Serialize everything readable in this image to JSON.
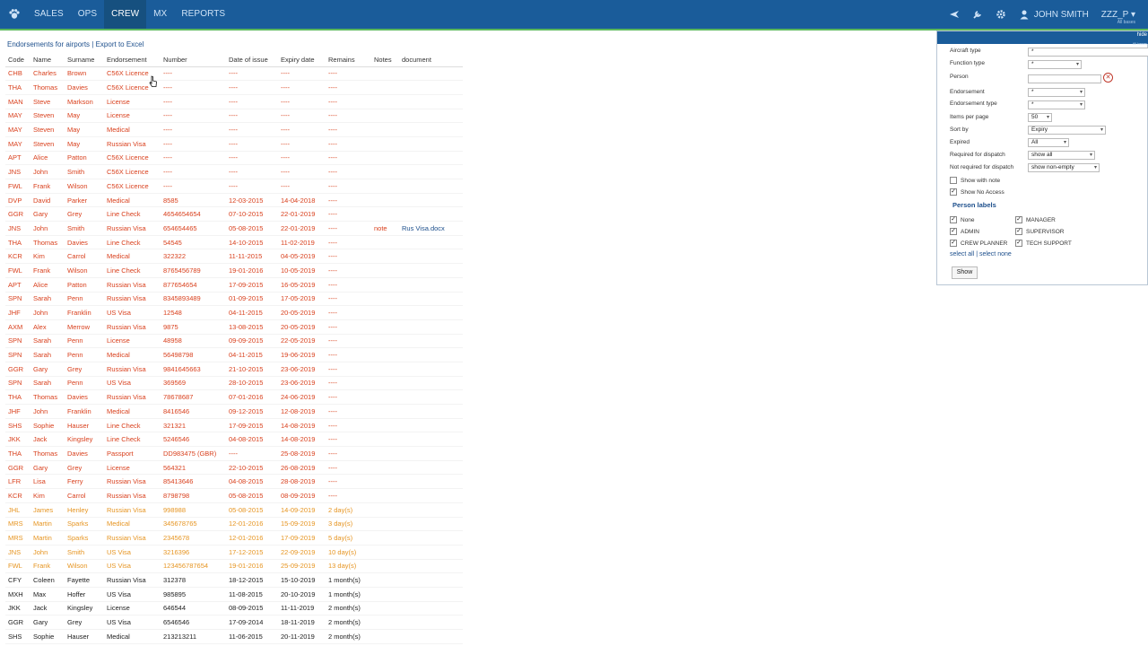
{
  "nav": {
    "items": [
      {
        "label": "SALES",
        "active": false
      },
      {
        "label": "OPS",
        "active": false
      },
      {
        "label": "CREW",
        "active": true
      },
      {
        "label": "MX",
        "active": false
      },
      {
        "label": "REPORTS",
        "active": false
      }
    ],
    "user_name": "JOHN SMITH",
    "workspace": "ZZZ_P",
    "workspace_sub": "All bases"
  },
  "breadcrumb": {
    "title": "Endorsements for airports",
    "separator": "|",
    "export_link": "Export to Excel"
  },
  "table": {
    "headers": [
      "Code",
      "Name",
      "Surname",
      "Endorsement",
      "Number",
      "Date of issue",
      "Expiry date",
      "Remains",
      "Notes",
      "document"
    ],
    "rows": [
      {
        "code": "CHB",
        "name": "Charles",
        "surname": "Brown",
        "endorsement": "C56X Licence",
        "number": "----",
        "issue": "----",
        "expiry": "----",
        "remains": "----",
        "notes": "",
        "document": "",
        "status": "expired"
      },
      {
        "code": "THA",
        "name": "Thomas",
        "surname": "Davies",
        "endorsement": "C56X Licence",
        "number": "----",
        "issue": "----",
        "expiry": "----",
        "remains": "----",
        "notes": "",
        "document": "",
        "status": "expired"
      },
      {
        "code": "MAN",
        "name": "Steve",
        "surname": "Markson",
        "endorsement": "License",
        "number": "----",
        "issue": "----",
        "expiry": "----",
        "remains": "----",
        "notes": "",
        "document": "",
        "status": "expired"
      },
      {
        "code": "MAY",
        "name": "Steven",
        "surname": "May",
        "endorsement": "License",
        "number": "----",
        "issue": "----",
        "expiry": "----",
        "remains": "----",
        "notes": "",
        "document": "",
        "status": "expired"
      },
      {
        "code": "MAY",
        "name": "Steven",
        "surname": "May",
        "endorsement": "Medical",
        "number": "----",
        "issue": "----",
        "expiry": "----",
        "remains": "----",
        "notes": "",
        "document": "",
        "status": "expired"
      },
      {
        "code": "MAY",
        "name": "Steven",
        "surname": "May",
        "endorsement": "Russian Visa",
        "number": "----",
        "issue": "----",
        "expiry": "----",
        "remains": "----",
        "notes": "",
        "document": "",
        "status": "expired"
      },
      {
        "code": "APT",
        "name": "Alice",
        "surname": "Patton",
        "endorsement": "C56X Licence",
        "number": "----",
        "issue": "----",
        "expiry": "----",
        "remains": "----",
        "notes": "",
        "document": "",
        "status": "expired"
      },
      {
        "code": "JNS",
        "name": "John",
        "surname": "Smith",
        "endorsement": "C56X Licence",
        "number": "----",
        "issue": "----",
        "expiry": "----",
        "remains": "----",
        "notes": "",
        "document": "",
        "status": "expired"
      },
      {
        "code": "FWL",
        "name": "Frank",
        "surname": "Wilson",
        "endorsement": "C56X Licence",
        "number": "----",
        "issue": "----",
        "expiry": "----",
        "remains": "----",
        "notes": "",
        "document": "",
        "status": "expired"
      },
      {
        "code": "DVP",
        "name": "David",
        "surname": "Parker",
        "endorsement": "Medical",
        "number": "8585",
        "issue": "12-03-2015",
        "expiry": "14-04-2018",
        "remains": "----",
        "notes": "",
        "document": "",
        "status": "expired"
      },
      {
        "code": "GGR",
        "name": "Gary",
        "surname": "Grey",
        "endorsement": "Line Check",
        "number": "4654654654",
        "issue": "07-10-2015",
        "expiry": "22-01-2019",
        "remains": "----",
        "notes": "",
        "document": "",
        "status": "expired"
      },
      {
        "code": "JNS",
        "name": "John",
        "surname": "Smith",
        "endorsement": "Russian Visa",
        "number": "654654465",
        "issue": "05-08-2015",
        "expiry": "22-01-2019",
        "remains": "----",
        "notes": "note",
        "document": "Rus Visa.docx",
        "status": "expired"
      },
      {
        "code": "THA",
        "name": "Thomas",
        "surname": "Davies",
        "endorsement": "Line Check",
        "number": "54545",
        "issue": "14-10-2015",
        "expiry": "11-02-2019",
        "remains": "----",
        "notes": "",
        "document": "",
        "status": "expired"
      },
      {
        "code": "KCR",
        "name": "Kim",
        "surname": "Carrol",
        "endorsement": "Medical",
        "number": "322322",
        "issue": "11-11-2015",
        "expiry": "04-05-2019",
        "remains": "----",
        "notes": "",
        "document": "",
        "status": "expired"
      },
      {
        "code": "FWL",
        "name": "Frank",
        "surname": "Wilson",
        "endorsement": "Line Check",
        "number": "8765456789",
        "issue": "19-01-2016",
        "expiry": "10-05-2019",
        "remains": "----",
        "notes": "",
        "document": "",
        "status": "expired"
      },
      {
        "code": "APT",
        "name": "Alice",
        "surname": "Patton",
        "endorsement": "Russian Visa",
        "number": "877654654",
        "issue": "17-09-2015",
        "expiry": "16-05-2019",
        "remains": "----",
        "notes": "",
        "document": "",
        "status": "expired"
      },
      {
        "code": "SPN",
        "name": "Sarah",
        "surname": "Penn",
        "endorsement": "Russian Visa",
        "number": "8345893489",
        "issue": "01-09-2015",
        "expiry": "17-05-2019",
        "remains": "----",
        "notes": "",
        "document": "",
        "status": "expired"
      },
      {
        "code": "JHF",
        "name": "John",
        "surname": "Franklin",
        "endorsement": "US Visa",
        "number": "12548",
        "issue": "04-11-2015",
        "expiry": "20-05-2019",
        "remains": "----",
        "notes": "",
        "document": "",
        "status": "expired"
      },
      {
        "code": "AXM",
        "name": "Alex",
        "surname": "Merrow",
        "endorsement": "Russian Visa",
        "number": "9875",
        "issue": "13-08-2015",
        "expiry": "20-05-2019",
        "remains": "----",
        "notes": "",
        "document": "",
        "status": "expired"
      },
      {
        "code": "SPN",
        "name": "Sarah",
        "surname": "Penn",
        "endorsement": "License",
        "number": "48958",
        "issue": "09-09-2015",
        "expiry": "22-05-2019",
        "remains": "----",
        "notes": "",
        "document": "",
        "status": "expired"
      },
      {
        "code": "SPN",
        "name": "Sarah",
        "surname": "Penn",
        "endorsement": "Medical",
        "number": "56498798",
        "issue": "04-11-2015",
        "expiry": "19-06-2019",
        "remains": "----",
        "notes": "",
        "document": "",
        "status": "expired"
      },
      {
        "code": "GGR",
        "name": "Gary",
        "surname": "Grey",
        "endorsement": "Russian Visa",
        "number": "9841645663",
        "issue": "21-10-2015",
        "expiry": "23-06-2019",
        "remains": "----",
        "notes": "",
        "document": "",
        "status": "expired"
      },
      {
        "code": "SPN",
        "name": "Sarah",
        "surname": "Penn",
        "endorsement": "US Visa",
        "number": "369569",
        "issue": "28-10-2015",
        "expiry": "23-06-2019",
        "remains": "----",
        "notes": "",
        "document": "",
        "status": "expired"
      },
      {
        "code": "THA",
        "name": "Thomas",
        "surname": "Davies",
        "endorsement": "Russian Visa",
        "number": "78678687",
        "issue": "07-01-2016",
        "expiry": "24-06-2019",
        "remains": "----",
        "notes": "",
        "document": "",
        "status": "expired"
      },
      {
        "code": "JHF",
        "name": "John",
        "surname": "Franklin",
        "endorsement": "Medical",
        "number": "8416546",
        "issue": "09-12-2015",
        "expiry": "12-08-2019",
        "remains": "----",
        "notes": "",
        "document": "",
        "status": "expired"
      },
      {
        "code": "SHS",
        "name": "Sophie",
        "surname": "Hauser",
        "endorsement": "Line Check",
        "number": "321321",
        "issue": "17-09-2015",
        "expiry": "14-08-2019",
        "remains": "----",
        "notes": "",
        "document": "",
        "status": "expired"
      },
      {
        "code": "JKK",
        "name": "Jack",
        "surname": "Kingsley",
        "endorsement": "Line Check",
        "number": "5246546",
        "issue": "04-08-2015",
        "expiry": "14-08-2019",
        "remains": "----",
        "notes": "",
        "document": "",
        "status": "expired"
      },
      {
        "code": "THA",
        "name": "Thomas",
        "surname": "Davies",
        "endorsement": "Passport",
        "number": "DD983475 (GBR)",
        "issue": "----",
        "expiry": "25-08-2019",
        "remains": "----",
        "notes": "",
        "document": "",
        "status": "expired"
      },
      {
        "code": "GGR",
        "name": "Gary",
        "surname": "Grey",
        "endorsement": "License",
        "number": "564321",
        "issue": "22-10-2015",
        "expiry": "26-08-2019",
        "remains": "----",
        "notes": "",
        "document": "",
        "status": "expired"
      },
      {
        "code": "LFR",
        "name": "Lisa",
        "surname": "Ferry",
        "endorsement": "Russian Visa",
        "number": "85413646",
        "issue": "04-08-2015",
        "expiry": "28-08-2019",
        "remains": "----",
        "notes": "",
        "document": "",
        "status": "expired"
      },
      {
        "code": "KCR",
        "name": "Kim",
        "surname": "Carrol",
        "endorsement": "Russian Visa",
        "number": "8798798",
        "issue": "05-08-2015",
        "expiry": "08-09-2019",
        "remains": "----",
        "notes": "",
        "document": "",
        "status": "expired"
      },
      {
        "code": "JHL",
        "name": "James",
        "surname": "Henley",
        "endorsement": "Russian Visa",
        "number": "998988",
        "issue": "05-08-2015",
        "expiry": "14-09-2019",
        "remains": "2 day(s)",
        "notes": "",
        "document": "",
        "status": "warn"
      },
      {
        "code": "MRS",
        "name": "Martin",
        "surname": "Sparks",
        "endorsement": "Medical",
        "number": "345678765",
        "issue": "12-01-2016",
        "expiry": "15-09-2019",
        "remains": "3 day(s)",
        "notes": "",
        "document": "",
        "status": "warn"
      },
      {
        "code": "MRS",
        "name": "Martin",
        "surname": "Sparks",
        "endorsement": "Russian Visa",
        "number": "2345678",
        "issue": "12-01-2016",
        "expiry": "17-09-2019",
        "remains": "5 day(s)",
        "notes": "",
        "document": "",
        "status": "warn"
      },
      {
        "code": "JNS",
        "name": "John",
        "surname": "Smith",
        "endorsement": "US Visa",
        "number": "3216396",
        "issue": "17-12-2015",
        "expiry": "22-09-2019",
        "remains": "10 day(s)",
        "notes": "",
        "document": "",
        "status": "warn"
      },
      {
        "code": "FWL",
        "name": "Frank",
        "surname": "Wilson",
        "endorsement": "US Visa",
        "number": "123456787654",
        "issue": "19-01-2016",
        "expiry": "25-09-2019",
        "remains": "13 day(s)",
        "notes": "",
        "document": "",
        "status": "warn"
      },
      {
        "code": "CFY",
        "name": "Coleen",
        "surname": "Fayette",
        "endorsement": "Russian Visa",
        "number": "312378",
        "issue": "18-12-2015",
        "expiry": "15-10-2019",
        "remains": "1 month(s)",
        "notes": "",
        "document": "",
        "status": "ok"
      },
      {
        "code": "MXH",
        "name": "Max",
        "surname": "Hoffer",
        "endorsement": "US Visa",
        "number": "985895",
        "issue": "11-08-2015",
        "expiry": "20-10-2019",
        "remains": "1 month(s)",
        "notes": "",
        "document": "",
        "status": "ok"
      },
      {
        "code": "JKK",
        "name": "Jack",
        "surname": "Kingsley",
        "endorsement": "License",
        "number": "646544",
        "issue": "08-09-2015",
        "expiry": "11-11-2019",
        "remains": "2 month(s)",
        "notes": "",
        "document": "",
        "status": "ok"
      },
      {
        "code": "GGR",
        "name": "Gary",
        "surname": "Grey",
        "endorsement": "US Visa",
        "number": "6546546",
        "issue": "17-09-2014",
        "expiry": "18-11-2019",
        "remains": "2 month(s)",
        "notes": "",
        "document": "",
        "status": "ok"
      },
      {
        "code": "SHS",
        "name": "Sophie",
        "surname": "Hauser",
        "endorsement": "Medical",
        "number": "213213211",
        "issue": "11-06-2015",
        "expiry": "20-11-2019",
        "remains": "2 month(s)",
        "notes": "",
        "document": "",
        "status": "ok"
      }
    ]
  },
  "filters": {
    "hide_label": "hide",
    "all_bases": "All bases",
    "aircraft_type": {
      "label": "Aircraft type",
      "value": "*"
    },
    "function_type": {
      "label": "Function type",
      "value": "*"
    },
    "person": {
      "label": "Person",
      "value": ""
    },
    "endorsement": {
      "label": "Endorsement",
      "value": "*"
    },
    "endorsement_type": {
      "label": "Endorsement type",
      "value": "*"
    },
    "items_per_page": {
      "label": "Items per page",
      "value": "50"
    },
    "sort_by": {
      "label": "Sort by",
      "value": "Expiry"
    },
    "expired": {
      "label": "Expired",
      "value": "All"
    },
    "required_dispatch": {
      "label": "Required for dispatch",
      "value": "show all"
    },
    "not_required_dispatch": {
      "label": "Not required for dispatch",
      "value": "show non-empty"
    },
    "show_with_note": {
      "label": "Show with note",
      "checked": false
    },
    "show_no_access": {
      "label": "Show No Access",
      "checked": true
    },
    "person_labels_title": "Person labels",
    "labels": [
      {
        "label": "None",
        "checked": true
      },
      {
        "label": "MANAGER",
        "checked": true
      },
      {
        "label": "ADMIN",
        "checked": true
      },
      {
        "label": "SUPERVISOR",
        "checked": true
      },
      {
        "label": "CREW PLANNER",
        "checked": true
      },
      {
        "label": "TECH SUPPORT",
        "checked": true
      }
    ],
    "select_all": "select all",
    "select_sep": "|",
    "select_none": "select none",
    "show_button": "Show"
  },
  "colors": {
    "topbar": "#1a5c9a",
    "expired": "#d9411e",
    "warn": "#e69522",
    "link": "#1d4f8c"
  }
}
